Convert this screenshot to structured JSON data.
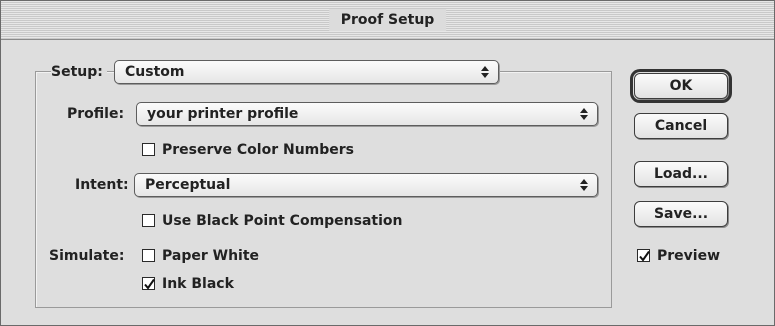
{
  "window": {
    "title": "Proof Setup"
  },
  "setup": {
    "label": "Setup:",
    "value": "Custom"
  },
  "profile": {
    "label": "Profile:",
    "value": "your printer profile"
  },
  "preserve_color_numbers": {
    "label": "Preserve Color Numbers",
    "checked": false
  },
  "intent": {
    "label": "Intent:",
    "value": "Perceptual"
  },
  "black_point_compensation": {
    "label": "Use Black Point Compensation",
    "checked": false
  },
  "simulate": {
    "label": "Simulate:",
    "paper_white": {
      "label": "Paper White",
      "checked": false
    },
    "ink_black": {
      "label": "Ink Black",
      "checked": true
    }
  },
  "buttons": {
    "ok": "OK",
    "cancel": "Cancel",
    "load": "Load...",
    "save": "Save..."
  },
  "preview": {
    "label": "Preview",
    "checked": true
  }
}
